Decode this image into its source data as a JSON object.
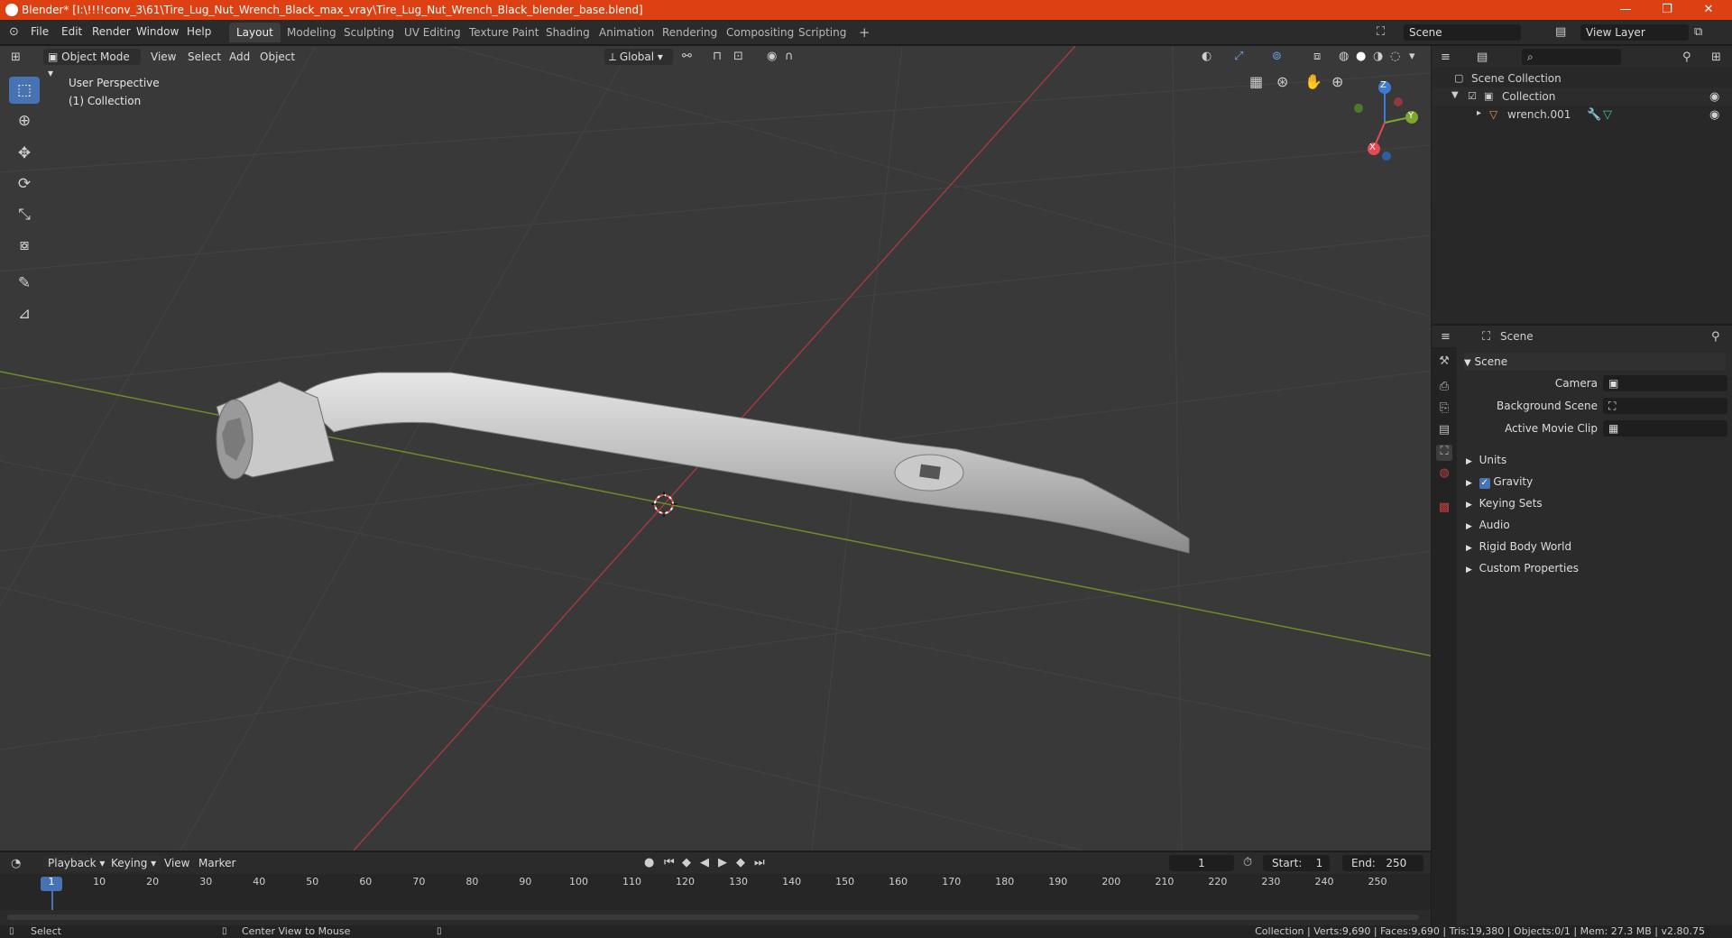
{
  "window": {
    "title": "Blender* [I:\\!!!!conv_3\\61\\Tire_Lug_Nut_Wrench_Black_max_vray\\Tire_Lug_Nut_Wrench_Black_blender_base.blend]",
    "minimize": "—",
    "maximize": "❐",
    "close": "✕"
  },
  "menus": [
    "File",
    "Edit",
    "Render",
    "Window",
    "Help"
  ],
  "workspaces": [
    "Layout",
    "Modeling",
    "Sculpting",
    "UV Editing",
    "Texture Paint",
    "Shading",
    "Animation",
    "Rendering",
    "Compositing",
    "Scripting"
  ],
  "add_workspace": "+",
  "scene_field": "Scene",
  "view_layer_field": "View Layer",
  "viewport_header": {
    "mode": "Object Mode",
    "menus": [
      "View",
      "Select",
      "Add",
      "Object"
    ],
    "orientation": "Global"
  },
  "viewport": {
    "perspective": "User Perspective",
    "collection": "(1) Collection",
    "gizmo": {
      "x": "X",
      "y": "Y",
      "z": "Z"
    }
  },
  "outliner": {
    "root": "Scene Collection",
    "collection": "Collection",
    "object": "wrench.001"
  },
  "properties": {
    "header": "Scene",
    "panel": "Scene",
    "fields": [
      {
        "label": "Camera"
      },
      {
        "label": "Background Scene"
      },
      {
        "label": "Active Movie Clip"
      }
    ],
    "subpanels": [
      "Units",
      "Gravity",
      "Keying Sets",
      "Audio",
      "Rigid Body World",
      "Custom Properties"
    ],
    "gravity_checked": true
  },
  "timeline": {
    "menus": [
      "Playback",
      "Keying",
      "View",
      "Marker"
    ],
    "current_frame": "1",
    "start_label": "Start:",
    "start": "1",
    "end_label": "End:",
    "end": "250",
    "ticks": [
      "1",
      "10",
      "20",
      "30",
      "40",
      "50",
      "60",
      "70",
      "80",
      "90",
      "100",
      "110",
      "120",
      "130",
      "140",
      "150",
      "160",
      "170",
      "180",
      "190",
      "200",
      "210",
      "220",
      "230",
      "240",
      "250"
    ]
  },
  "statusbar": {
    "select": "Select",
    "center": "Center View to Mouse",
    "stats": "Collection | Verts:9,690 | Faces:9,690 | Tris:19,380 | Objects:0/1 | Mem: 27.3 MB | v2.80.75"
  },
  "colors": {
    "titlebar": "#dd4113",
    "accent": "#4772b3",
    "x_axis": "#e34a54",
    "y_axis": "#7ea62f",
    "z_axis": "#3f7ad6"
  }
}
